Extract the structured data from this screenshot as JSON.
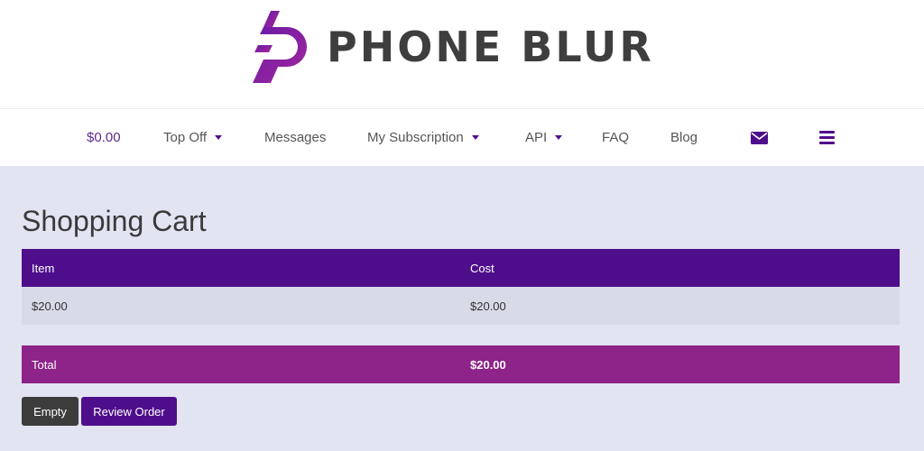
{
  "brand": {
    "name": "PHONE BLUR",
    "accent": "#4e0e8b",
    "accent_secondary": "#8e2389"
  },
  "nav": {
    "balance": "$0.00",
    "top_off": "Top Off",
    "messages": "Messages",
    "subscription": "My Subscription",
    "api": "API",
    "faq": "FAQ",
    "blog": "Blog",
    "icons": [
      "envelope-icon",
      "hamburger-menu-icon"
    ]
  },
  "cart": {
    "title": "Shopping Cart",
    "headers": {
      "item": "Item",
      "cost": "Cost"
    },
    "rows": [
      {
        "item": "$20.00",
        "cost": "$20.00"
      }
    ],
    "total_label": "Total",
    "total_value": "$20.00"
  },
  "buttons": {
    "empty": "Empty",
    "review": "Review Order"
  }
}
